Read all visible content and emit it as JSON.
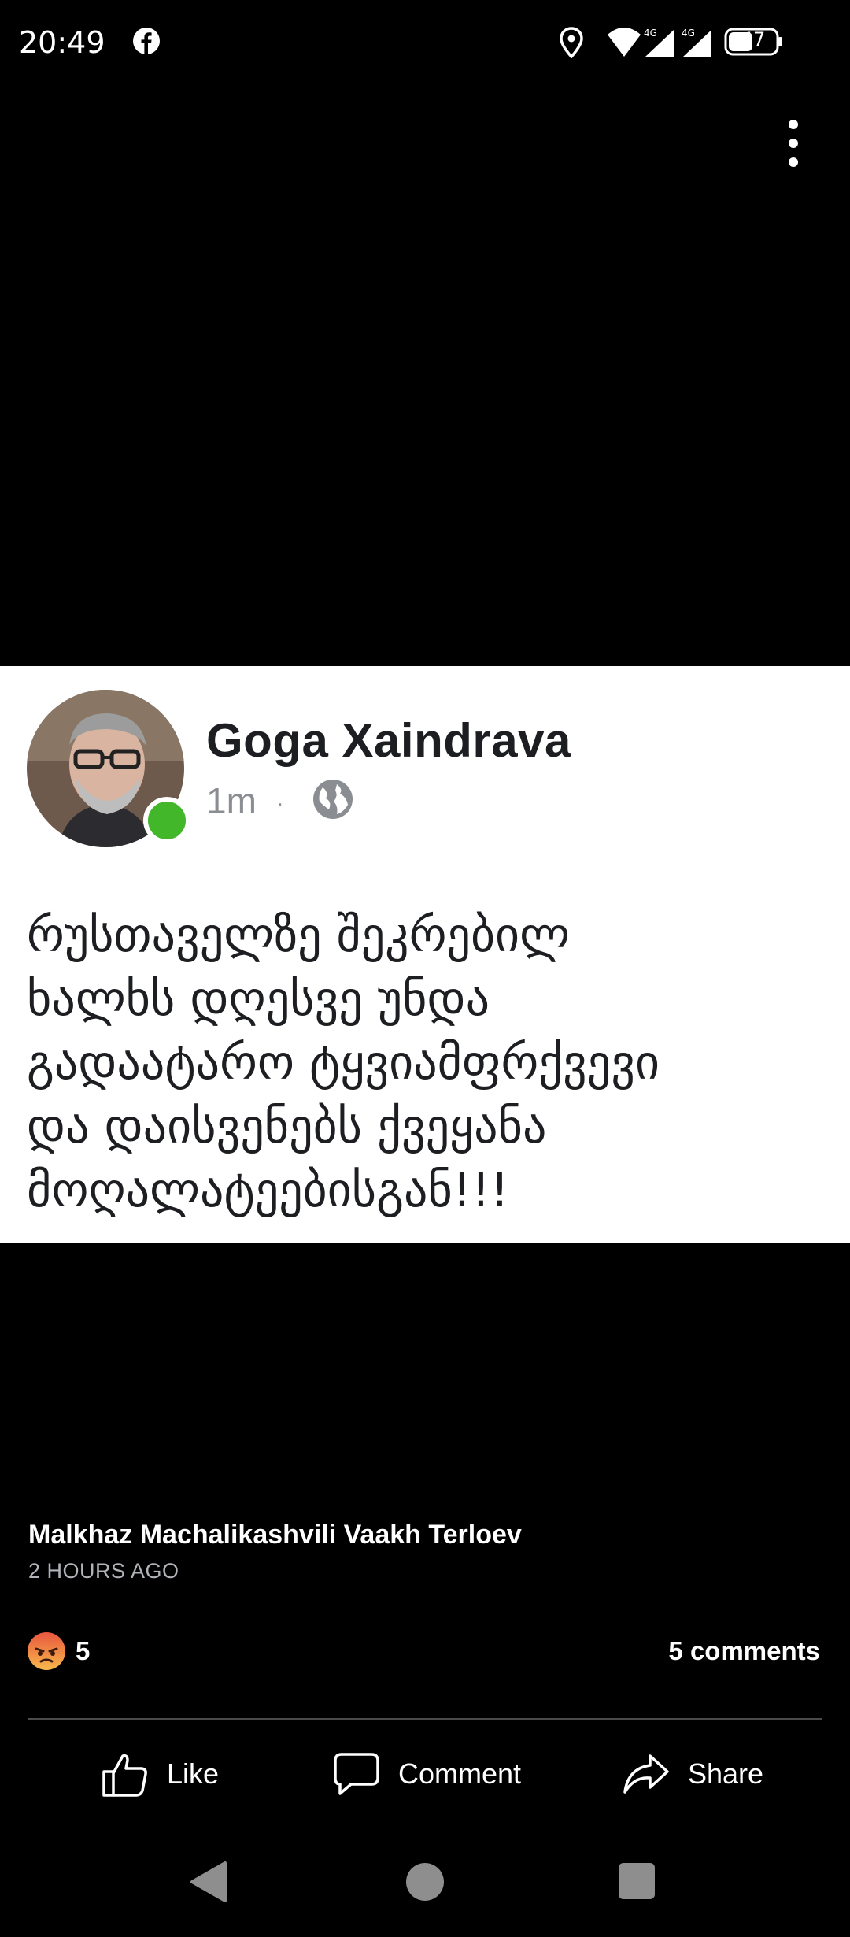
{
  "status_bar": {
    "time": "20:49",
    "battery": "47",
    "icons": [
      "facebook-icon",
      "location-icon",
      "wifi-icon",
      "signal-4g-icon",
      "signal-4g-icon",
      "battery-icon"
    ]
  },
  "post_image": {
    "author": "Goga Xaindrava",
    "time": "1m",
    "separator": "·",
    "privacy_icon": "globe-icon",
    "online_color": "#42b72a",
    "body": "რუსთაველზე შეკრებილ\nხალხს დღესვე უნდა\nგადაატარო ტყვიამფრქვევი\nდა დაისვენებს ქვეყანა\nმოღალატეებისგან!!!"
  },
  "caption": {
    "names": "Malkhaz Machalikashvili Vaakh Terloev",
    "timestamp": "2 HOURS AGO"
  },
  "reactions": {
    "icon": "angry-reaction-icon",
    "count": "5",
    "comments": "5 comments"
  },
  "actions": {
    "like": "Like",
    "comment": "Comment",
    "share": "Share"
  },
  "colors": {
    "background": "#000000",
    "card": "#ffffff",
    "muted": "#b0b3b8"
  }
}
